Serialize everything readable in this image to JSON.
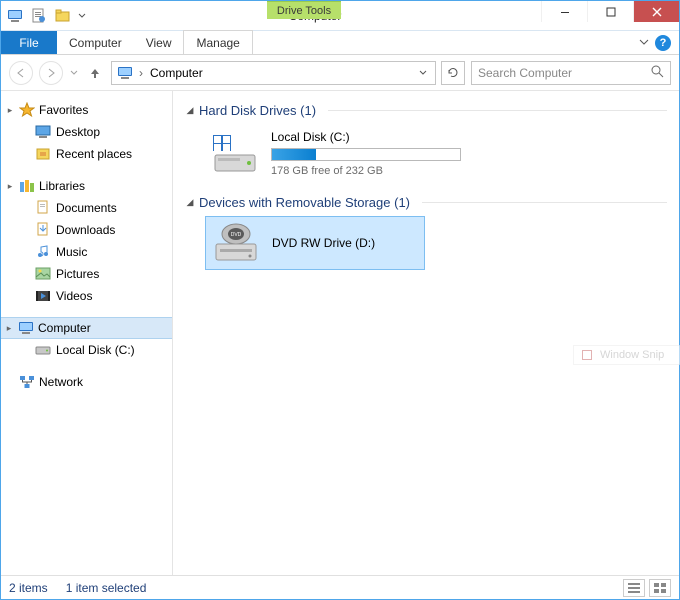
{
  "window": {
    "title": "Computer",
    "drive_tools_label": "Drive Tools"
  },
  "ribbon": {
    "file": "File",
    "tabs": [
      "Computer",
      "View",
      "Manage"
    ]
  },
  "address": {
    "location": "Computer"
  },
  "search": {
    "placeholder": "Search Computer"
  },
  "sidebar": {
    "groups": [
      {
        "label": "Favorites",
        "items": [
          "Desktop",
          "Recent places"
        ]
      },
      {
        "label": "Libraries",
        "items": [
          "Documents",
          "Downloads",
          "Music",
          "Pictures",
          "Videos"
        ]
      },
      {
        "label": "Computer",
        "items": [
          "Local Disk (C:)"
        ],
        "selected": true
      },
      {
        "label": "Network",
        "items": []
      }
    ]
  },
  "content": {
    "sections": [
      {
        "title": "Hard Disk Drives",
        "count": 1,
        "drives": [
          {
            "name": "Local Disk (C:)",
            "free_text": "178 GB free of 232 GB",
            "used_fraction": 0.233
          }
        ]
      },
      {
        "title": "Devices with Removable Storage",
        "count": 1,
        "devices": [
          {
            "name": "DVD RW Drive (D:)",
            "selected": true
          }
        ]
      }
    ]
  },
  "status": {
    "items_label": "2 items",
    "selected_label": "1 item selected"
  },
  "ghost": {
    "label": "Window Snip"
  }
}
